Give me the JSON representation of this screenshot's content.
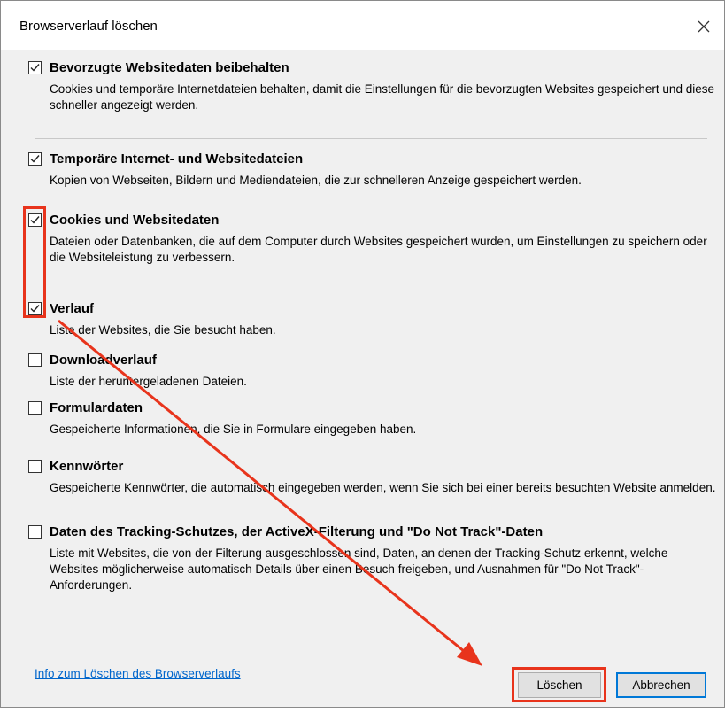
{
  "window": {
    "title": "Browserverlauf löschen",
    "close_symbol": "✕"
  },
  "options": [
    {
      "label": "Bevorzugte Websitedaten beibehalten",
      "checked": true,
      "desc": "Cookies und temporäre Internetdateien behalten, damit die Einstellungen für die bevorzugten Websites gespeichert und diese schneller angezeigt werden."
    },
    {
      "label": "Temporäre Internet- und Websitedateien",
      "checked": true,
      "desc": "Kopien von Webseiten, Bildern und Mediendateien, die zur schnelleren Anzeige gespeichert werden."
    },
    {
      "label": "Cookies und Websitedaten",
      "checked": true,
      "desc": "Dateien oder Datenbanken, die auf dem Computer durch Websites gespeichert wurden, um Einstellungen zu speichern oder die Websiteleistung zu verbessern."
    },
    {
      "label": "Verlauf",
      "checked": true,
      "desc": "Liste der Websites, die Sie besucht haben."
    },
    {
      "label": "Downloadverlauf",
      "checked": false,
      "desc": "Liste der heruntergeladenen Dateien."
    },
    {
      "label": "Formulardaten",
      "checked": false,
      "desc": "Gespeicherte Informationen, die Sie in Formulare eingegeben haben."
    },
    {
      "label": "Kennwörter",
      "checked": false,
      "desc": "Gespeicherte Kennwörter, die automatisch eingegeben werden, wenn Sie sich bei einer bereits besuchten Website anmelden."
    },
    {
      "label": "Daten des Tracking-Schutzes, der ActiveX-Filterung und \"Do Not Track\"-Daten",
      "checked": false,
      "desc": "Liste mit Websites, die von der Filterung ausgeschlossen sind, Daten, an denen der Tracking-Schutz erkennt, welche Websites möglicherweise automatisch Details über einen Besuch freigeben, und Ausnahmen für \"Do Not Track\"-Anforderungen."
    }
  ],
  "footer": {
    "link": "Info zum Löschen des Browserverlaufs",
    "delete_button": "Löschen",
    "cancel_button": "Abbrechen"
  },
  "annotation": {
    "color": "#e8341c"
  }
}
